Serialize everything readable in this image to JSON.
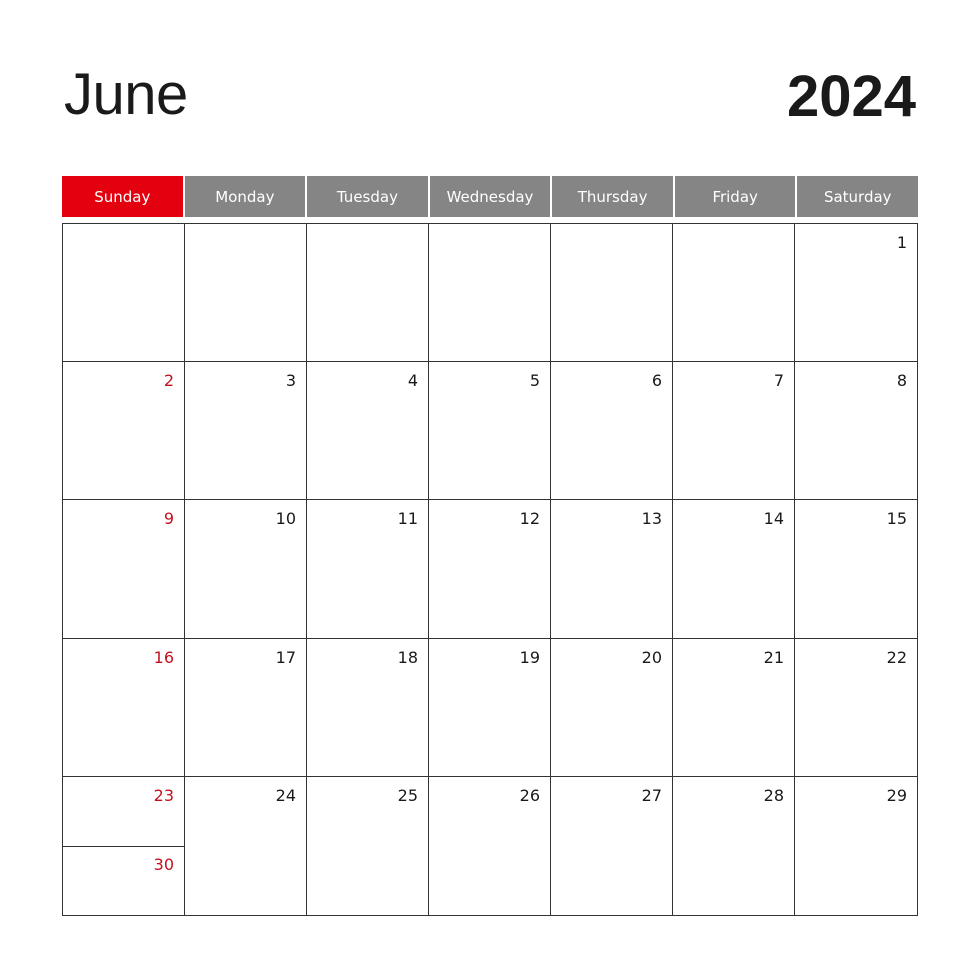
{
  "calendar": {
    "month": "June",
    "year": "2024",
    "weekdays": [
      "Sunday",
      "Monday",
      "Tuesday",
      "Wednesday",
      "Thursday",
      "Friday",
      "Saturday"
    ],
    "weeks": [
      [
        "",
        "",
        "",
        "",
        "",
        "",
        "1"
      ],
      [
        "2",
        "3",
        "4",
        "5",
        "6",
        "7",
        "8"
      ],
      [
        "9",
        "10",
        "11",
        "12",
        "13",
        "14",
        "15"
      ],
      [
        "16",
        "17",
        "18",
        "19",
        "20",
        "21",
        "22"
      ],
      [
        "23",
        "24",
        "25",
        "26",
        "27",
        "28",
        "29"
      ]
    ],
    "overflow": {
      "week": 4,
      "day": 0,
      "value": "30"
    },
    "colors": {
      "sunday_accent": "#e3000f",
      "sunday_text": "#c1121f",
      "header_gray": "#858585",
      "text": "#1a1a1a"
    }
  }
}
